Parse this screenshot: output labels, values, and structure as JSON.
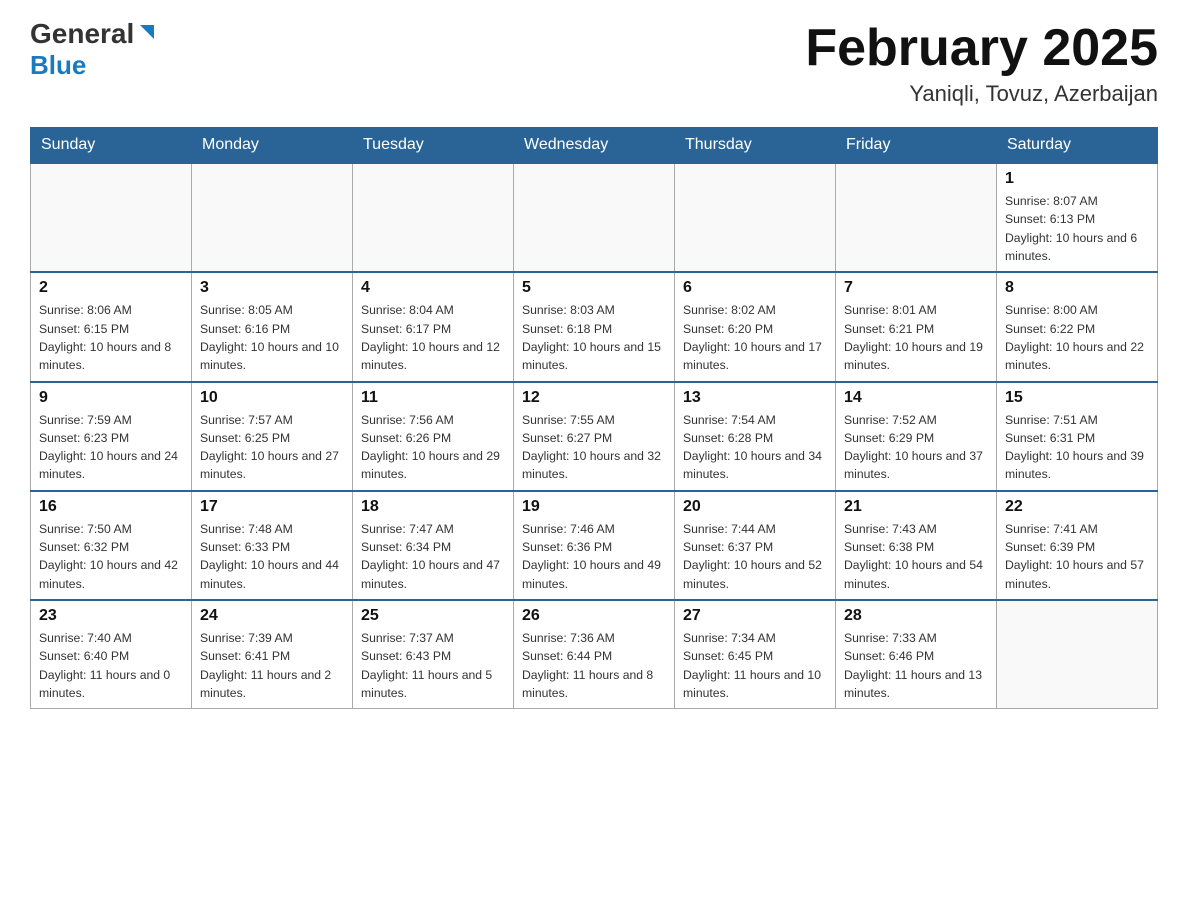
{
  "header": {
    "logo_general": "General",
    "logo_blue": "Blue",
    "title": "February 2025",
    "subtitle": "Yaniqli, Tovuz, Azerbaijan"
  },
  "days_of_week": [
    "Sunday",
    "Monday",
    "Tuesday",
    "Wednesday",
    "Thursday",
    "Friday",
    "Saturday"
  ],
  "weeks": [
    {
      "days": [
        {
          "number": "",
          "info": ""
        },
        {
          "number": "",
          "info": ""
        },
        {
          "number": "",
          "info": ""
        },
        {
          "number": "",
          "info": ""
        },
        {
          "number": "",
          "info": ""
        },
        {
          "number": "",
          "info": ""
        },
        {
          "number": "1",
          "info": "Sunrise: 8:07 AM\nSunset: 6:13 PM\nDaylight: 10 hours and 6 minutes."
        }
      ]
    },
    {
      "days": [
        {
          "number": "2",
          "info": "Sunrise: 8:06 AM\nSunset: 6:15 PM\nDaylight: 10 hours and 8 minutes."
        },
        {
          "number": "3",
          "info": "Sunrise: 8:05 AM\nSunset: 6:16 PM\nDaylight: 10 hours and 10 minutes."
        },
        {
          "number": "4",
          "info": "Sunrise: 8:04 AM\nSunset: 6:17 PM\nDaylight: 10 hours and 12 minutes."
        },
        {
          "number": "5",
          "info": "Sunrise: 8:03 AM\nSunset: 6:18 PM\nDaylight: 10 hours and 15 minutes."
        },
        {
          "number": "6",
          "info": "Sunrise: 8:02 AM\nSunset: 6:20 PM\nDaylight: 10 hours and 17 minutes."
        },
        {
          "number": "7",
          "info": "Sunrise: 8:01 AM\nSunset: 6:21 PM\nDaylight: 10 hours and 19 minutes."
        },
        {
          "number": "8",
          "info": "Sunrise: 8:00 AM\nSunset: 6:22 PM\nDaylight: 10 hours and 22 minutes."
        }
      ]
    },
    {
      "days": [
        {
          "number": "9",
          "info": "Sunrise: 7:59 AM\nSunset: 6:23 PM\nDaylight: 10 hours and 24 minutes."
        },
        {
          "number": "10",
          "info": "Sunrise: 7:57 AM\nSunset: 6:25 PM\nDaylight: 10 hours and 27 minutes."
        },
        {
          "number": "11",
          "info": "Sunrise: 7:56 AM\nSunset: 6:26 PM\nDaylight: 10 hours and 29 minutes."
        },
        {
          "number": "12",
          "info": "Sunrise: 7:55 AM\nSunset: 6:27 PM\nDaylight: 10 hours and 32 minutes."
        },
        {
          "number": "13",
          "info": "Sunrise: 7:54 AM\nSunset: 6:28 PM\nDaylight: 10 hours and 34 minutes."
        },
        {
          "number": "14",
          "info": "Sunrise: 7:52 AM\nSunset: 6:29 PM\nDaylight: 10 hours and 37 minutes."
        },
        {
          "number": "15",
          "info": "Sunrise: 7:51 AM\nSunset: 6:31 PM\nDaylight: 10 hours and 39 minutes."
        }
      ]
    },
    {
      "days": [
        {
          "number": "16",
          "info": "Sunrise: 7:50 AM\nSunset: 6:32 PM\nDaylight: 10 hours and 42 minutes."
        },
        {
          "number": "17",
          "info": "Sunrise: 7:48 AM\nSunset: 6:33 PM\nDaylight: 10 hours and 44 minutes."
        },
        {
          "number": "18",
          "info": "Sunrise: 7:47 AM\nSunset: 6:34 PM\nDaylight: 10 hours and 47 minutes."
        },
        {
          "number": "19",
          "info": "Sunrise: 7:46 AM\nSunset: 6:36 PM\nDaylight: 10 hours and 49 minutes."
        },
        {
          "number": "20",
          "info": "Sunrise: 7:44 AM\nSunset: 6:37 PM\nDaylight: 10 hours and 52 minutes."
        },
        {
          "number": "21",
          "info": "Sunrise: 7:43 AM\nSunset: 6:38 PM\nDaylight: 10 hours and 54 minutes."
        },
        {
          "number": "22",
          "info": "Sunrise: 7:41 AM\nSunset: 6:39 PM\nDaylight: 10 hours and 57 minutes."
        }
      ]
    },
    {
      "days": [
        {
          "number": "23",
          "info": "Sunrise: 7:40 AM\nSunset: 6:40 PM\nDaylight: 11 hours and 0 minutes."
        },
        {
          "number": "24",
          "info": "Sunrise: 7:39 AM\nSunset: 6:41 PM\nDaylight: 11 hours and 2 minutes."
        },
        {
          "number": "25",
          "info": "Sunrise: 7:37 AM\nSunset: 6:43 PM\nDaylight: 11 hours and 5 minutes."
        },
        {
          "number": "26",
          "info": "Sunrise: 7:36 AM\nSunset: 6:44 PM\nDaylight: 11 hours and 8 minutes."
        },
        {
          "number": "27",
          "info": "Sunrise: 7:34 AM\nSunset: 6:45 PM\nDaylight: 11 hours and 10 minutes."
        },
        {
          "number": "28",
          "info": "Sunrise: 7:33 AM\nSunset: 6:46 PM\nDaylight: 11 hours and 13 minutes."
        },
        {
          "number": "",
          "info": ""
        }
      ]
    }
  ]
}
